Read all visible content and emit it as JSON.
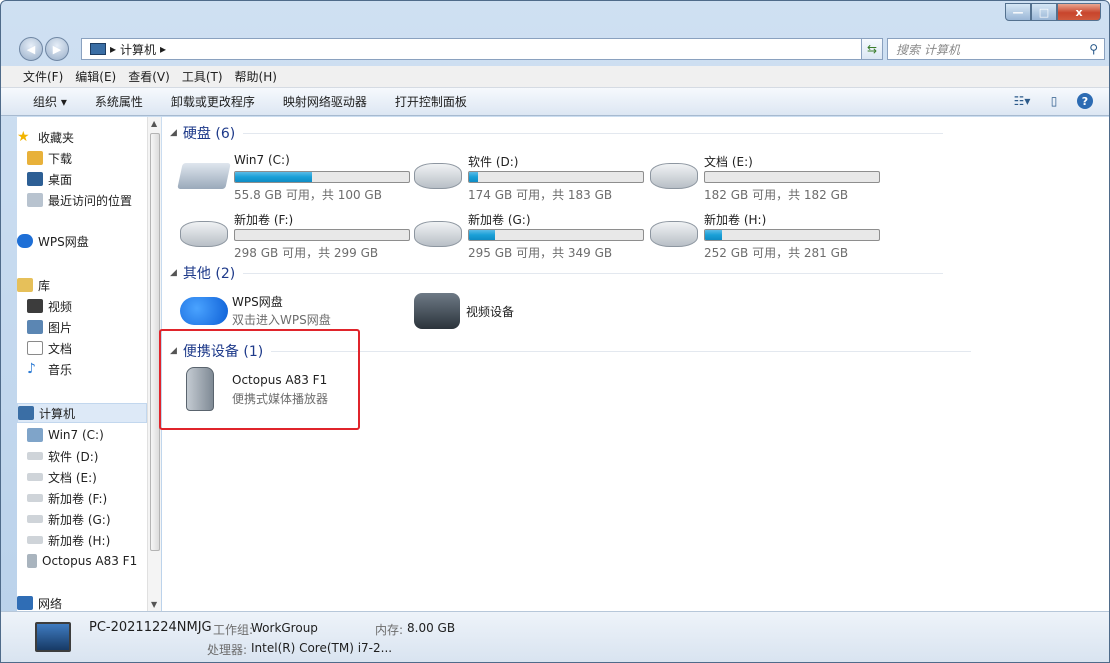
{
  "window": {
    "minimize": "—",
    "maximize": "□",
    "close": "x"
  },
  "address": {
    "path": [
      "计算机"
    ],
    "separator": "▸",
    "search_placeholder": "搜索 计算机"
  },
  "menu": [
    "文件(F)",
    "编辑(E)",
    "查看(V)",
    "工具(T)",
    "帮助(H)"
  ],
  "toolbar": [
    "组织 ▾",
    "系统属性",
    "卸载或更改程序",
    "映射网络驱动器",
    "打开控制面板"
  ],
  "nav": {
    "favorites": {
      "label": "收藏夹",
      "items": [
        "下载",
        "桌面",
        "最近访问的位置"
      ]
    },
    "wps": "WPS网盘",
    "libraries": {
      "label": "库",
      "items": [
        "视频",
        "图片",
        "文档",
        "音乐"
      ]
    },
    "computer": {
      "label": "计算机",
      "items": [
        "Win7 (C:)",
        "软件 (D:)",
        "文档 (E:)",
        "新加卷 (F:)",
        "新加卷 (G:)",
        "新加卷 (H:)",
        "Octopus A83 F1"
      ]
    },
    "network": "网络"
  },
  "groups": {
    "hard_disks": "硬盘 (6)",
    "others": "其他 (2)",
    "portable": "便携设备 (1)"
  },
  "drives": [
    {
      "name": "Win7 (C:)",
      "size": "55.8 GB 可用，共 100 GB",
      "used": 0.44
    },
    {
      "name": "软件 (D:)",
      "size": "174 GB 可用，共 183 GB",
      "used": 0.05
    },
    {
      "name": "文档 (E:)",
      "size": "182 GB 可用，共 182 GB",
      "used": 0.0
    },
    {
      "name": "新加卷 (F:)",
      "size": "298 GB 可用，共 299 GB",
      "used": 0.0
    },
    {
      "name": "新加卷 (G:)",
      "size": "295 GB 可用，共 349 GB",
      "used": 0.15
    },
    {
      "name": "新加卷 (H:)",
      "size": "252 GB 可用，共 281 GB",
      "used": 0.1
    }
  ],
  "others": [
    {
      "name": "WPS网盘",
      "sub": "双击进入WPS网盘"
    },
    {
      "name": "视频设备",
      "sub": ""
    }
  ],
  "portable": [
    {
      "name": "Octopus A83 F1",
      "sub": "便携式媒体播放器"
    }
  ],
  "details": {
    "pc_name": "PC-20211224NMJG",
    "workgroup_label": "工作组:",
    "workgroup": "WorkGroup",
    "memory_label": "内存:",
    "memory": "8.00 GB",
    "cpu_label": "处理器:",
    "cpu": "Intel(R) Core(TM) i7-2..."
  }
}
